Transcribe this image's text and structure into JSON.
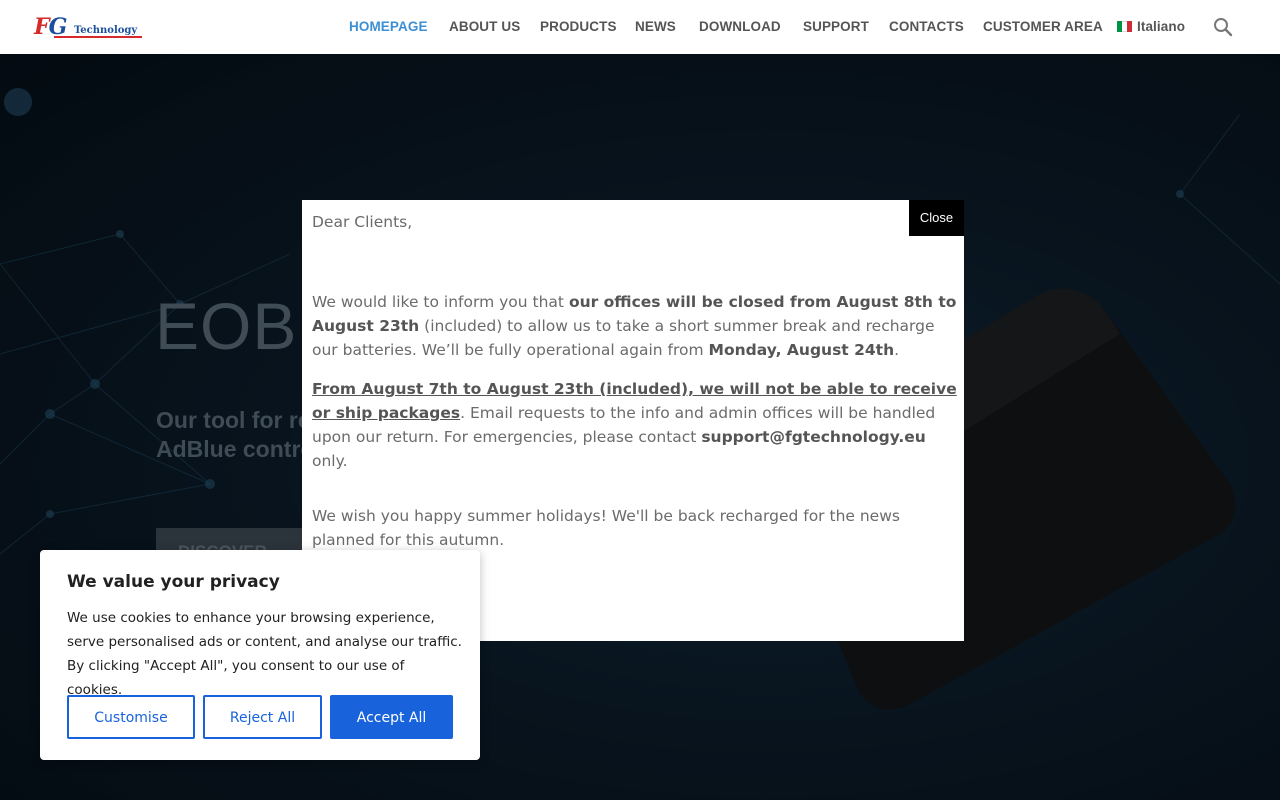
{
  "brand": {
    "logo_letters": "FG",
    "logo_text": "Technology"
  },
  "nav": {
    "items": [
      {
        "label": "HOMEPAGE",
        "active": true
      },
      {
        "label": "ABOUT US"
      },
      {
        "label": "PRODUCTS"
      },
      {
        "label": "NEWS"
      },
      {
        "label": "DOWNLOAD"
      },
      {
        "label": "SUPPORT"
      },
      {
        "label": "CONTACTS"
      },
      {
        "label": "CUSTOMER AREA"
      }
    ],
    "language": "Italiano",
    "language_flag_icon": "italy-flag-icon",
    "search_icon": "search-icon",
    "active_color": "#3d8fd4"
  },
  "hero": {
    "title": "EOB",
    "subtitle_line1": "Our tool for re",
    "subtitle_line2": "AdBlue contro",
    "button_label": "DISCOVER"
  },
  "notice": {
    "close_label": "Close",
    "greeting": "Dear Clients,",
    "p1_a": "We would like to inform you that ",
    "p1_b": "our offices will be closed from August 8th to August 23th",
    "p1_c": " (included) to allow us to take a short summer break and recharge our batteries. We’ll be fully operational again from ",
    "p1_d": "Monday, August 24th",
    "p1_e": ".",
    "p2_a": "From August 7th to August 23th (included), we will not be able to receive or ship packages",
    "p2_b": ". Email requests to the info and admin offices will be handled upon our return. For emergencies, please contact ",
    "p2_c": "support@fgtechnology.eu",
    "p2_d": " only.",
    "p3": "We wish you happy summer holidays! We'll be back recharged for the news planned for this autumn."
  },
  "cookie": {
    "title": "We value your privacy",
    "text": "We use cookies to enhance your browsing experience, serve personalised ads or content, and analyse our traffic. By clicking \"Accept All\", you consent to our use of cookies.",
    "customise_label": "Customise",
    "reject_label": "Reject All",
    "accept_label": "Accept All",
    "accent_color": "#1863dc"
  }
}
